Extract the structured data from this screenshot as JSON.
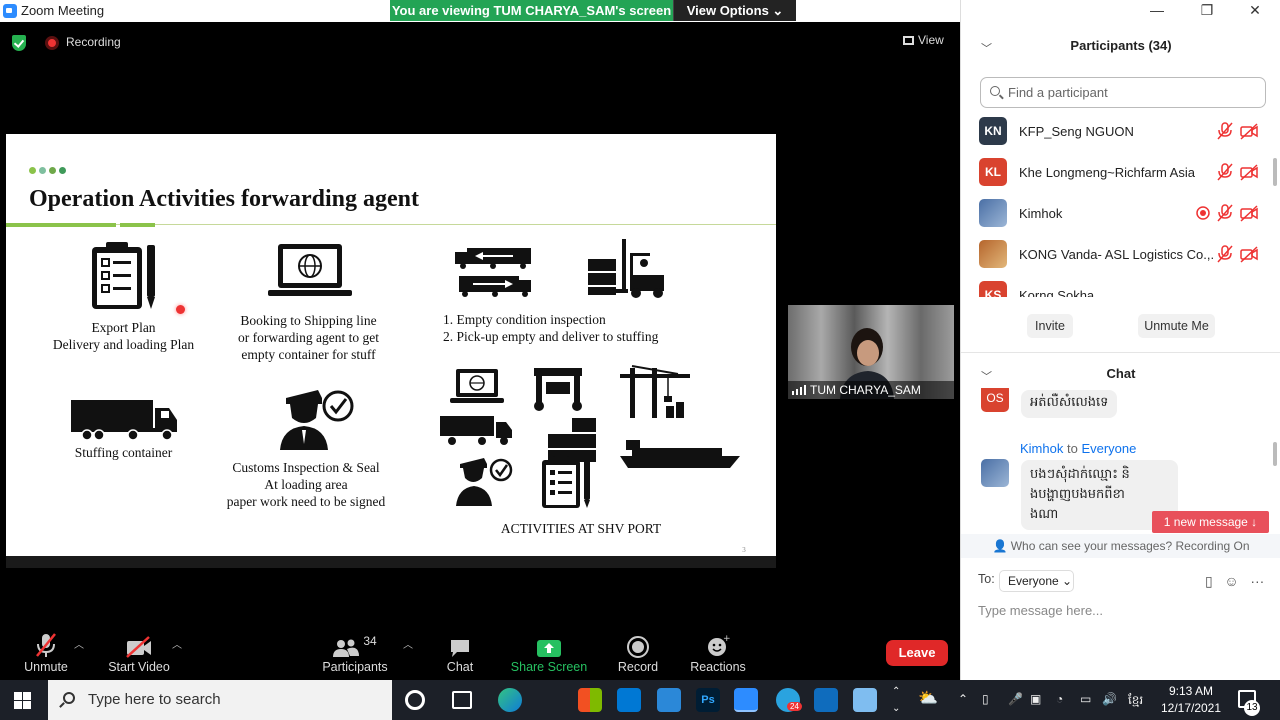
{
  "window": {
    "title": "Zoom Meeting"
  },
  "banner": {
    "viewing": "You are viewing TUM CHARYA_SAM's screen",
    "view_options": "View Options ⌄"
  },
  "stage": {
    "recording": "Recording",
    "view": "View"
  },
  "slide": {
    "title": "Operation Activities forwarding agent",
    "dot_colors": [
      "#8bc34a",
      "#7fbf9f",
      "#6fa84a",
      "#3f9a5a"
    ],
    "captions": {
      "export_plan": "Export Plan",
      "delivery_plan": "Delivery and loading Plan",
      "booking_1": "Booking to Shipping line",
      "booking_2": "or forwarding agent to get",
      "booking_3": "empty container for stuff",
      "step_1": "1.   Empty condition inspection",
      "step_2": "2.   Pick-up empty and deliver to stuffing",
      "stuffing": "Stuffing container",
      "customs_1": "Customs Inspection & Seal",
      "customs_2": "At loading area",
      "customs_3": "paper work need to be signed",
      "port": "ACTIVITIES AT SHV PORT"
    },
    "page_number": "3"
  },
  "video": {
    "name": "TUM CHARYA_SAM"
  },
  "toolbar": {
    "unmute": "Unmute",
    "start_video": "Start Video",
    "participants_count": "34",
    "participants": "Participants",
    "chat": "Chat",
    "share_screen": "Share Screen",
    "record": "Record",
    "reactions": "Reactions",
    "leave": "Leave"
  },
  "panel": {
    "participants_title": "Participants (34)",
    "search_placeholder": "Find a participant",
    "participants": [
      {
        "initials": "KN",
        "name": "KFP_Seng NGUON",
        "color": "#2d3a4a"
      },
      {
        "initials": "KL",
        "name": "Khe Longmeng~Richfarm Asia",
        "color": "#d9432f"
      },
      {
        "initials": "",
        "name": "Kimhok",
        "color": "#4a6fa5"
      },
      {
        "initials": "",
        "name": "KONG Vanda- ASL Logistics Co.,...",
        "color": "#b5652c"
      },
      {
        "initials": "KS",
        "name": "Korng Sokha",
        "color": "#d9432f"
      }
    ],
    "invite": "Invite",
    "unmute_me": "Unmute Me",
    "chat_title": "Chat",
    "chat_prev_initials": "OS",
    "chat_prev_text": "អត់លឺសំលេងទេ",
    "chat_sender": "Kimhok",
    "chat_to": "to",
    "chat_recipient": "Everyone",
    "chat_line_1": "បងៗសុំដាក់ឈ្មោះ និ",
    "chat_line_2": "ងបង្ហាញបងមកពីខា",
    "chat_line_3": "ងណា",
    "new_message": "1 new message ↓",
    "privacy": "Who can see your messages? Recording On",
    "to_label": "To:",
    "to_value": "Everyone ⌄",
    "input_placeholder": "Type message here..."
  },
  "taskbar": {
    "search_placeholder": "Type here to search",
    "telegram_badge": "24",
    "time": "9:13 AM",
    "date": "12/17/2021",
    "notification_count": "13",
    "language": "ខ្មែរ"
  }
}
